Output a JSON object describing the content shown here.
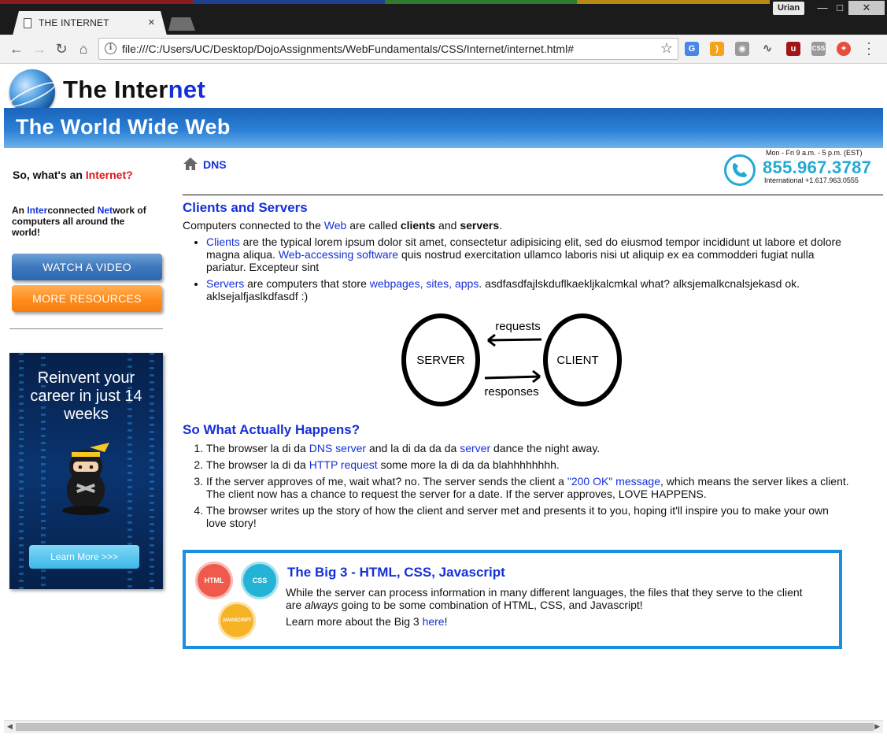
{
  "browser": {
    "tab_title": "THE INTERNET",
    "tab_close": "×",
    "profile": "Urian",
    "url": "file:///C:/Users/UC/Desktop/DojoAssignments/WebFundamentals/CSS/Internet/internet.html#",
    "extensions": [
      "translate-icon",
      "rss-icon",
      "camera-icon",
      "pulse-icon",
      "ublock-icon",
      "css-icon",
      "extension-red-icon"
    ]
  },
  "header": {
    "title_part1": "The Inter",
    "title_part2": "net",
    "banner": "The World Wide Web"
  },
  "sidebar": {
    "heading_prefix": "So, what's an ",
    "heading_highlight": "Internet?",
    "desc": {
      "p1": "An ",
      "h1": "Inter",
      "p2": "connected ",
      "h2": "Net",
      "p3": "work of computers all around the world!"
    },
    "watch_button": "WATCH A VIDEO",
    "resources_button": "MORE RESOURCES",
    "ad": {
      "headline": "Reinvent your career in just 14 weeks",
      "cta": "Learn More >>>"
    }
  },
  "main": {
    "breadcrumb": "DNS",
    "contact": {
      "hours": "Mon - Fri 9 a.m. - 5 p.m. (EST)",
      "phone": "855.967.3787",
      "international": "International +1.617.963.0555"
    },
    "section1": {
      "title": "Clients and Servers",
      "intro": {
        "t1": "Computers connected to the ",
        "l1": "Web",
        "t2": " are called ",
        "b1": "clients",
        "t3": " and ",
        "b2": "servers",
        "t4": "."
      },
      "bullets": [
        {
          "link1": "Clients",
          "text1": " are the typical lorem ipsum dolor sit amet, consectetur adipisicing elit, sed do eiusmod tempor incididunt ut labore et dolore magna aliqua. ",
          "link2": "Web-accessing software",
          "text2": " quis nostrud exercitation ullamco laboris nisi ut aliquip ex ea commodderi fugiat nulla pariatur. Excepteur sint"
        },
        {
          "link1": "Servers",
          "text1": " are computers that store ",
          "link2": "webpages, sites, apps",
          "text2": ". asdfasdfajlskduflkaekljkalcmkal what? alksjemalkcnalsjekasd ok. aklsejalfjaslkdfasdf :)"
        }
      ],
      "diagram": {
        "server": "SERVER",
        "client": "CLIENT",
        "requests": "requests",
        "responses": "responses"
      }
    },
    "section2": {
      "title": "So What Actually Happens?",
      "steps": [
        {
          "t1": "The browser la di da ",
          "l1": "DNS server",
          "t2": " and la di da da da ",
          "l2": "server",
          "t3": " dance the night away."
        },
        {
          "t1": "The browser la di da ",
          "l1": "HTTP request",
          "t2": " some more la di da da blahhhhhhhh.",
          "l2": "",
          "t3": ""
        },
        {
          "t1": "If the server approves of me, wait what? no. The server sends the client a ",
          "l1": "\"200 OK\" message",
          "t2": ", which means the server likes a client. The client now has a chance to request the server for a date. If the server approves, LOVE HAPPENS.",
          "l2": "",
          "t3": ""
        },
        {
          "t1": "The browser writes up the story of how the client and server met and presents it to you, hoping it'll inspire you to make your own love story!",
          "l1": "",
          "t2": "",
          "l2": "",
          "t3": ""
        }
      ]
    },
    "big3": {
      "title": "The Big 3 - HTML, CSS, Javascript",
      "text1": "While the server can process information in many different languages, the files that they serve to the client are ",
      "em": "always",
      "text2": " going to be some combination of HTML, CSS, and Javascript!",
      "more_prefix": "Learn more about the Big 3 ",
      "more_link": "here",
      "more_suffix": "!",
      "badges": [
        {
          "label": "HTML",
          "color": "#ef5a4c"
        },
        {
          "label": "CSS",
          "color": "#22b3d6"
        },
        {
          "label": "JAVASCRIPT",
          "color": "#f7b326"
        }
      ]
    }
  },
  "colors": {
    "link_blue": "#1530d8",
    "accent_red": "#e0141b",
    "phone_blue": "#23a9d6",
    "box_border": "#1a8fde"
  }
}
